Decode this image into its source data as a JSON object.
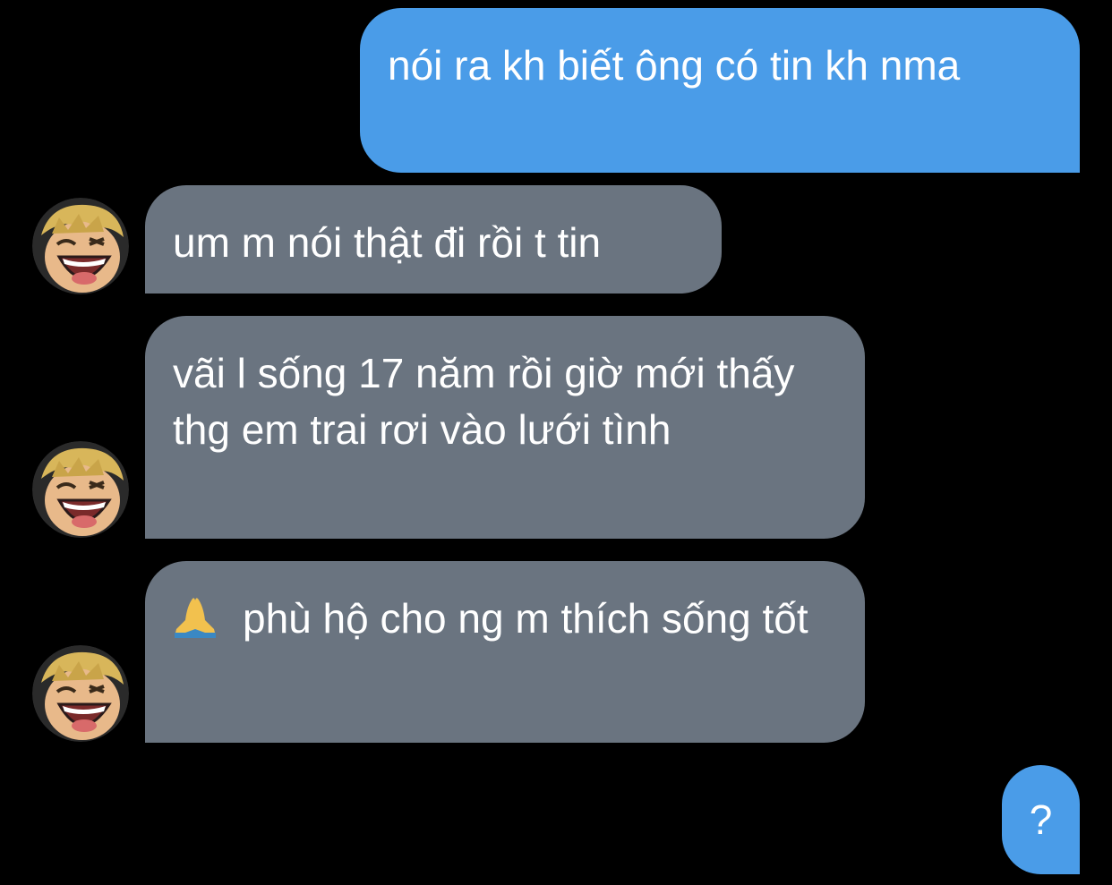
{
  "conversation": {
    "messages": [
      {
        "direction": "outgoing",
        "text": "nói ra kh biết ông có tin kh nma"
      },
      {
        "direction": "incoming",
        "text": "um m nói thật đi rồi t tin"
      },
      {
        "direction": "incoming",
        "text": "vãi l sống 17 năm rồi giờ mới thấy thg em trai rơi vào lưới tình"
      },
      {
        "direction": "incoming",
        "emoji": "praying-hands-emoji",
        "text": "phù hộ cho ng m thích sống tốt"
      },
      {
        "direction": "outgoing",
        "text": "?"
      }
    ]
  },
  "theme": {
    "background": "#000000",
    "outgoing_bubble": "#4a9ce8",
    "incoming_bubble": "#6a7480",
    "text_color": "#ffffff"
  },
  "avatar": {
    "icon": "laughing-anime-character-avatar"
  }
}
